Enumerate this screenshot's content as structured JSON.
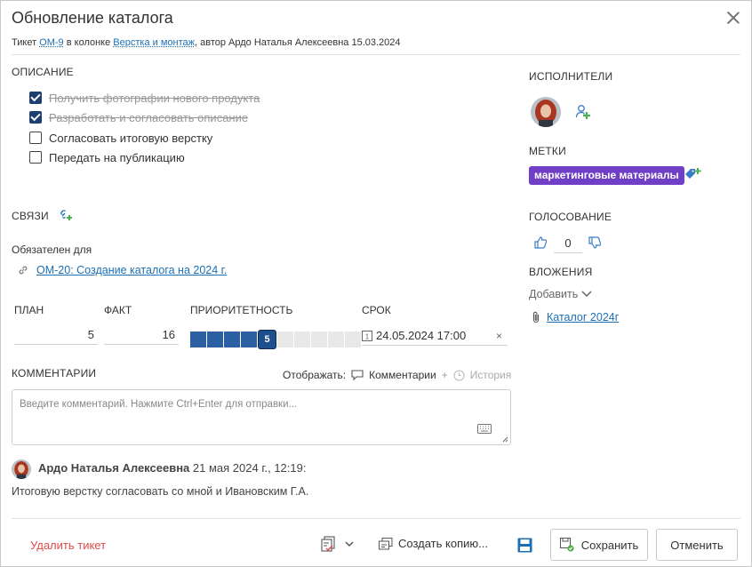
{
  "dialog": {
    "title": "Обновление каталога",
    "meta": {
      "prefix": "Тикет ",
      "ticket_id": "OM-9",
      "column_prefix": " в колонке ",
      "column": "Верстка и монтаж",
      "author_text": ", автор Ардо Наталья Алексеевна 15.03.2024"
    }
  },
  "description": {
    "heading": "ОПИСАНИЕ",
    "items": [
      {
        "label": "Получить фотографии нового продукта",
        "checked": true
      },
      {
        "label": "Разработать и согласовать описание",
        "checked": true
      },
      {
        "label": "Согласовать итоговую верстку",
        "checked": false
      },
      {
        "label": "Передать на публикацию",
        "checked": false
      }
    ]
  },
  "links": {
    "heading": "СВЯЗИ",
    "required_for_label": "Обязателен для",
    "items": [
      {
        "label": "OM-20: Создание каталога на 2024 г."
      }
    ]
  },
  "fields": {
    "plan_label": "ПЛАН",
    "plan_value": "5",
    "fact_label": "ФАКТ",
    "fact_value": "16",
    "priority_label": "ПРИОРИТЕТНОСТЬ",
    "priority_value": "5",
    "priority_level": 5,
    "priority_max": 10,
    "deadline_label": "СРОК",
    "deadline_value": "24.05.2024 17:00",
    "deadline_clear": "×"
  },
  "comments": {
    "heading": "КОММЕНТАРИИ",
    "show_label": "Отображать:",
    "filter_comments": "Комментарии",
    "plus": "+",
    "filter_history": "История",
    "placeholder": "Введите комментарий. Нажмите Ctrl+Enter для отправки...",
    "items": [
      {
        "author": "Ардо Наталья Алексеевна",
        "date": "21 мая 2024 г., 12:19:",
        "text": "Итоговую верстку согласовать со мной и Ивановским Г.А."
      }
    ]
  },
  "sidebar": {
    "assignees_heading": "ИСПОЛНИТЕЛИ",
    "tags_heading": "МЕТКИ",
    "tag": "маркетинговые материалы",
    "voting_heading": "ГОЛОСОВАНИЕ",
    "vote_count": "0",
    "attachments_heading": "ВЛОЖЕНИЯ",
    "add_label": "Добавить",
    "attachments": [
      {
        "name": "Каталог 2024г"
      }
    ]
  },
  "footer": {
    "delete_label": "Удалить тикет",
    "copy_label": "Создать копию...",
    "save_label": "Сохранить",
    "cancel_label": "Отменить"
  },
  "colors": {
    "link": "#1b6fb5",
    "tag_bg": "#6f3fc6",
    "priority": "#2d5fa3",
    "delete": "#e04b4b",
    "accent_green": "#4caf50"
  }
}
